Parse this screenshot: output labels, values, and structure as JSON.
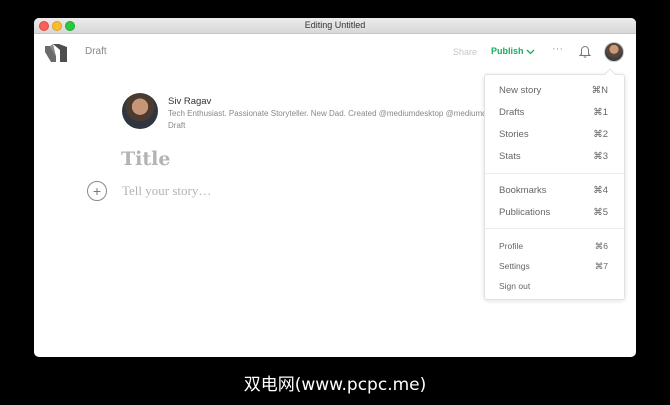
{
  "window": {
    "title": "Editing Untitled"
  },
  "appbar": {
    "status": "Draft",
    "share": "Share",
    "publish": "Publish",
    "more": "···"
  },
  "author": {
    "name": "Siv Ragav",
    "bio": "Tech Enthusiast. Passionate Storyteller. New Dad. Created @mediumdesktop @mediumdesktop",
    "status": "Draft"
  },
  "editor": {
    "title_placeholder": "Title",
    "body_placeholder": "Tell your story…",
    "add_button": "+"
  },
  "menu": {
    "group1": [
      {
        "label": "New story",
        "shortcut": "⌘N"
      },
      {
        "label": "Drafts",
        "shortcut": "⌘1"
      },
      {
        "label": "Stories",
        "shortcut": "⌘2"
      },
      {
        "label": "Stats",
        "shortcut": "⌘3"
      }
    ],
    "group2": [
      {
        "label": "Bookmarks",
        "shortcut": "⌘4"
      },
      {
        "label": "Publications",
        "shortcut": "⌘5"
      }
    ],
    "group3": [
      {
        "label": "Profile",
        "shortcut": "⌘6"
      },
      {
        "label": "Settings",
        "shortcut": "⌘7"
      },
      {
        "label": "Sign out",
        "shortcut": ""
      }
    ]
  },
  "caption": "双电网(www.pcpc.me)",
  "colors": {
    "accent": "#1aac61",
    "placeholder": "#b3b3b3"
  },
  "icons": [
    "medium-logo-icon",
    "chevron-down-icon",
    "more-icon",
    "bell-icon",
    "plus-icon"
  ]
}
